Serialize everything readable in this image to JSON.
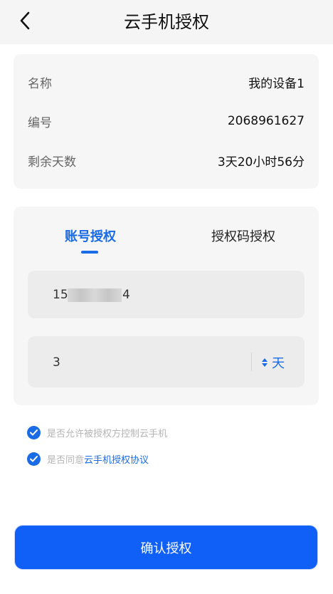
{
  "header": {
    "title": "云手机授权"
  },
  "device": {
    "name_label": "名称",
    "name_value": "我的设备1",
    "id_label": "编号",
    "id_value": "2068961627",
    "remaining_label": "剩余天数",
    "remaining_value": "3天20小时56分"
  },
  "auth": {
    "tabs": [
      {
        "label": "账号授权",
        "active": true
      },
      {
        "label": "授权码授权",
        "active": false
      }
    ],
    "account_prefix": "15",
    "account_suffix": "4",
    "days_value": "3",
    "unit_label": "天"
  },
  "agreements": {
    "allow_control": "是否允许被授权方控制云手机",
    "agree_prefix": "是否同意",
    "agree_link": "云手机授权协议"
  },
  "confirm_label": "确认授权",
  "colors": {
    "accent": "#1a6be6",
    "button": "#1060f8"
  }
}
